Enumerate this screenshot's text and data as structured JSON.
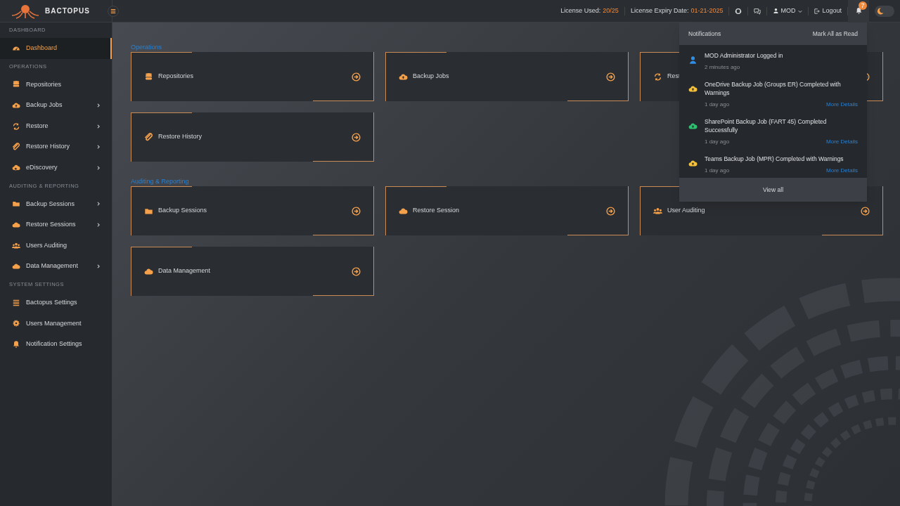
{
  "header": {
    "logo_text": "BACTOPUS",
    "license_used_label": "License Used:",
    "license_used": "20/25",
    "license_expiry_label": "License Expiry Date:",
    "license_expiry": "01-21-2025",
    "user": "MOD",
    "logout": "Logout",
    "notification_count": "7",
    "light_mode": false
  },
  "sidebar": {
    "sections": [
      {
        "title": "DASHBOARD",
        "items": [
          {
            "label": "Dashboard",
            "expandable": false,
            "selected": true
          }
        ]
      },
      {
        "title": "OPERATIONS",
        "items": [
          {
            "label": "Repositories",
            "expandable": false,
            "selected": false
          },
          {
            "label": "Backup Jobs",
            "expandable": true,
            "selected": false
          },
          {
            "label": "Restore",
            "expandable": true,
            "selected": false
          },
          {
            "label": "Restore History",
            "expandable": true,
            "selected": false
          },
          {
            "label": "eDiscovery",
            "expandable": true,
            "selected": false
          }
        ]
      },
      {
        "title": "AUDITING & REPORTING",
        "items": [
          {
            "label": "Backup Sessions",
            "expandable": true,
            "selected": false
          },
          {
            "label": "Restore Sessions",
            "expandable": true,
            "selected": false
          },
          {
            "label": "Users Auditing",
            "expandable": false,
            "selected": false
          },
          {
            "label": "Data Management",
            "expandable": true,
            "selected": false
          }
        ]
      },
      {
        "title": "SYSTEM SETTINGS",
        "items": [
          {
            "label": "Bactopus Settings",
            "expandable": false,
            "selected": false
          },
          {
            "label": "Users Management",
            "expandable": false,
            "selected": false
          },
          {
            "label": "Notification Settings",
            "expandable": false,
            "selected": false
          }
        ]
      }
    ]
  },
  "main": {
    "sections": [
      {
        "title": "Operations",
        "cards": [
          {
            "label": "Repositories"
          },
          {
            "label": "Backup Jobs"
          },
          {
            "label": "Rest"
          },
          {
            "label": "Restore History"
          }
        ]
      },
      {
        "title": "Auditing & Reporting",
        "cards": [
          {
            "label": "Backup Sessions"
          },
          {
            "label": "Restore Session"
          },
          {
            "label": "User Auditing"
          },
          {
            "label": "Data Management"
          }
        ]
      }
    ]
  },
  "notifications": {
    "title": "Notifications",
    "mark_all": "Mark All as Read",
    "items": [
      {
        "text": "MOD Administrator Logged in",
        "time": "2 minutes ago",
        "color": "#2f8ee6"
      },
      {
        "text": "OneDrive Backup Job (Groups ER) Completed with Warnings",
        "time": "1 day ago",
        "link": "More Details",
        "color": "#f4c13c"
      },
      {
        "text": "SharePoint Backup Job (FART 45) Completed Successfully",
        "time": "1 day ago",
        "link": "More Details",
        "color": "#2fbf71"
      },
      {
        "text": "Teams Backup Job (MPR) Completed with Warnings",
        "time": "1 day ago",
        "link": "More Details",
        "color": "#f4c13c"
      }
    ],
    "view_all": "View all"
  }
}
